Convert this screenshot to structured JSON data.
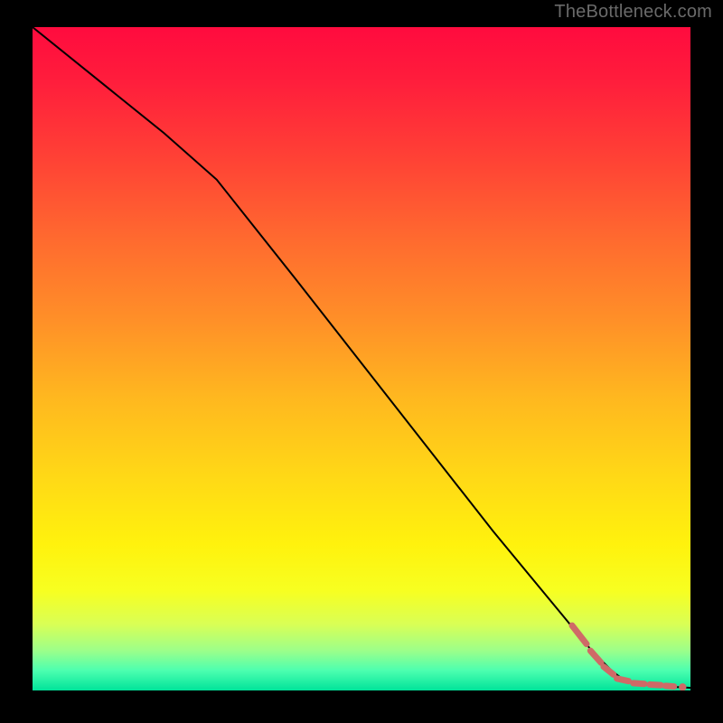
{
  "attribution": "TheBottleneck.com",
  "colors": {
    "curve": "#000000",
    "marker": "#cf6a67"
  },
  "chart_data": {
    "type": "line",
    "title": "",
    "xlabel": "",
    "ylabel": "",
    "xlim": [
      0,
      100
    ],
    "ylim": [
      0,
      100
    ],
    "series": [
      {
        "name": "curve",
        "x": [
          0,
          10,
          20,
          28,
          40,
          55,
          70,
          80,
          85,
          88,
          90,
          92,
          94,
          96,
          98,
          100
        ],
        "y": [
          100,
          92,
          84,
          77,
          62,
          43,
          24,
          12,
          6,
          3,
          1.5,
          1,
          0.8,
          0.6,
          0.5,
          0.4
        ]
      }
    ],
    "markers": {
      "dashes": [
        {
          "x0": 82.0,
          "y0": 9.8,
          "x1": 84.2,
          "y1": 7.0
        },
        {
          "x0": 84.8,
          "y0": 6.0,
          "x1": 86.4,
          "y1": 4.2
        },
        {
          "x0": 86.8,
          "y0": 3.6,
          "x1": 88.3,
          "y1": 2.4
        },
        {
          "x0": 88.8,
          "y0": 1.8,
          "x1": 90.6,
          "y1": 1.4
        },
        {
          "x0": 91.3,
          "y0": 1.1,
          "x1": 93.0,
          "y1": 1.0
        },
        {
          "x0": 93.8,
          "y0": 0.9,
          "x1": 95.5,
          "y1": 0.8
        },
        {
          "x0": 96.2,
          "y0": 0.7,
          "x1": 97.5,
          "y1": 0.6
        }
      ],
      "points": [
        {
          "x": 98.8,
          "y": 0.5
        }
      ]
    }
  }
}
